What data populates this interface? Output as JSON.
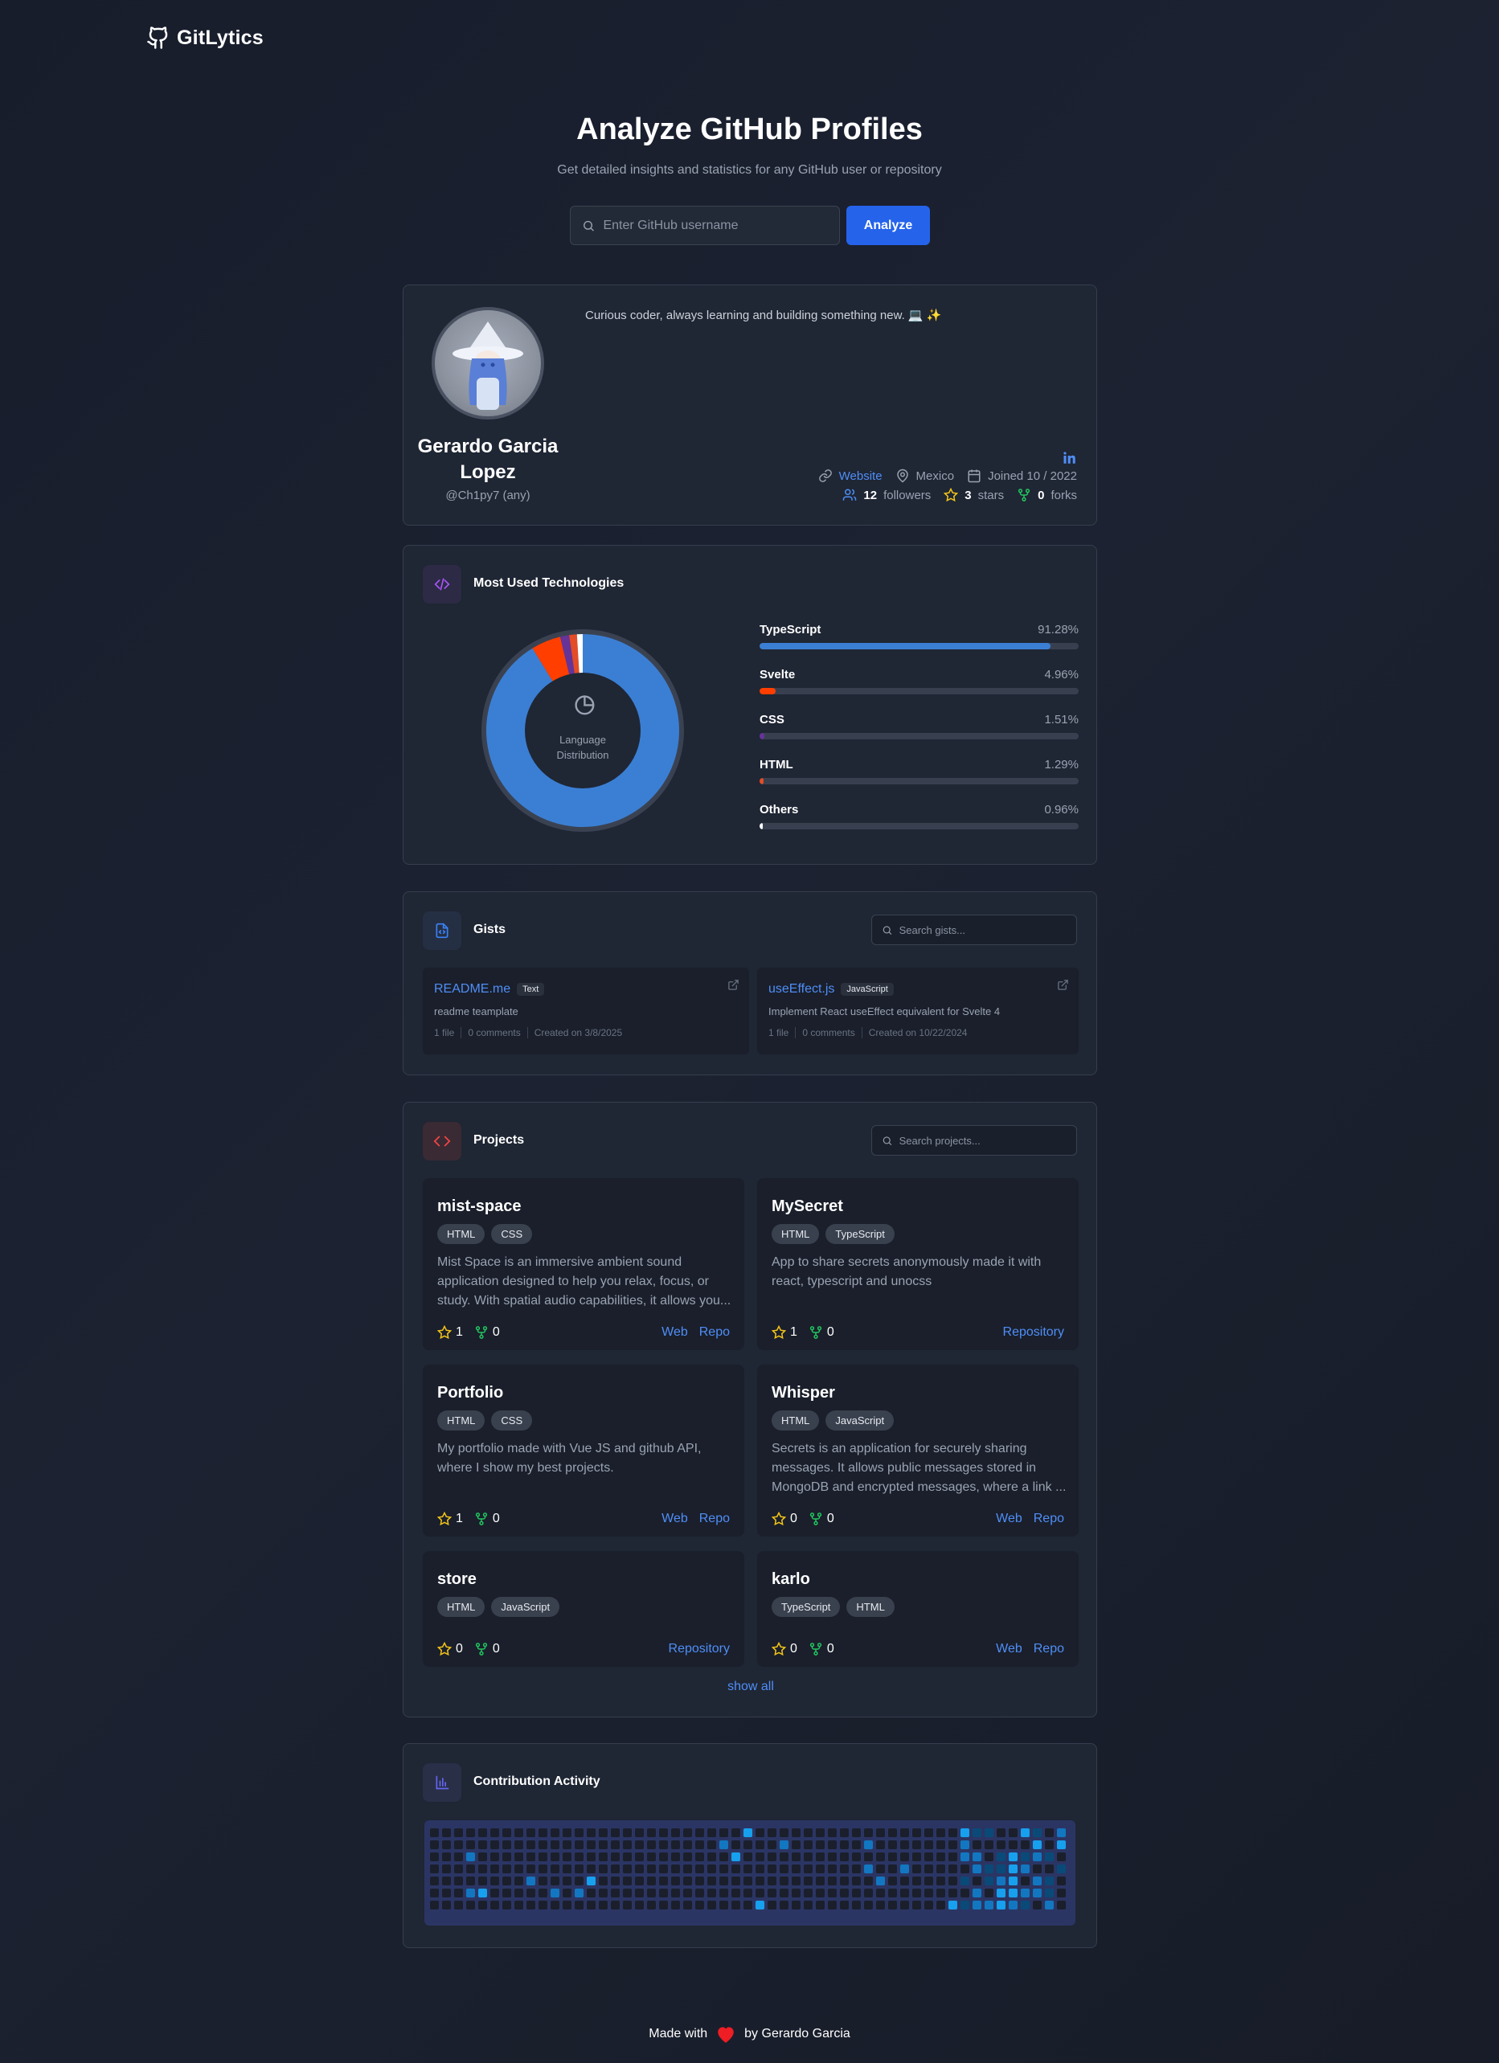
{
  "brand": {
    "name": "GitLytics"
  },
  "hero": {
    "title": "Analyze GitHub Profiles",
    "subtitle": "Get detailed insights and statistics for any GitHub user or repository",
    "search_placeholder": "Enter GitHub username",
    "analyze_label": "Analyze"
  },
  "profile": {
    "bio": "Curious coder, always learning and building something new. 💻 ✨",
    "name": "Gerardo Garcia Lopez",
    "handle": "@Ch1py7 (any)",
    "website_label": "Website",
    "location": "Mexico",
    "joined": "Joined 10 / 2022",
    "followers_count": "12",
    "followers_label": "followers",
    "stars_count": "3",
    "stars_label": "stars",
    "forks_count": "0",
    "forks_label": "forks"
  },
  "technologies": {
    "title": "Most Used Technologies",
    "chart_center_label": "Language Distribution",
    "languages": [
      {
        "name": "TypeScript",
        "pct": "91.28%",
        "value": 91.28,
        "color": "#3b7fd4"
      },
      {
        "name": "Svelte",
        "pct": "4.96%",
        "value": 4.96,
        "color": "#ff3e00"
      },
      {
        "name": "CSS",
        "pct": "1.51%",
        "value": 1.51,
        "color": "#663399"
      },
      {
        "name": "HTML",
        "pct": "1.29%",
        "value": 1.29,
        "color": "#e34c26"
      },
      {
        "name": "Others",
        "pct": "0.96%",
        "value": 0.96,
        "color": "#ffffff"
      }
    ]
  },
  "chart_data": {
    "type": "pie",
    "categories": [
      "TypeScript",
      "Svelte",
      "CSS",
      "HTML",
      "Others"
    ],
    "values": [
      91.28,
      4.96,
      1.51,
      1.29,
      0.96
    ],
    "title": "Most Used Technologies"
  },
  "gists": {
    "title": "Gists",
    "search_placeholder": "Search gists...",
    "items": [
      {
        "name": "README.me",
        "badge": "Text",
        "desc": "readme teamplate",
        "files": "1 file",
        "comments": "0 comments",
        "created": "Created on 3/8/2025"
      },
      {
        "name": "useEffect.js",
        "badge": "JavaScript",
        "desc": "Implement React useEffect equivalent for Svelte 4",
        "files": "1 file",
        "comments": "0 comments",
        "created": "Created on 10/22/2024"
      }
    ]
  },
  "projects": {
    "title": "Projects",
    "search_placeholder": "Search projects...",
    "show_all": "show all",
    "items": [
      {
        "name": "mist-space",
        "tags": [
          "HTML",
          "CSS"
        ],
        "desc": "Mist Space is an immersive ambient sound application designed to help you relax, focus, or study. With spatial audio capabilities, it allows you...",
        "stars": "1",
        "forks": "0",
        "links": [
          "Web",
          "Repo"
        ]
      },
      {
        "name": "MySecret",
        "tags": [
          "HTML",
          "TypeScript"
        ],
        "desc": "App to share secrets anonymously made it with react, typescript and unocss",
        "stars": "1",
        "forks": "0",
        "links": [
          "Repository"
        ]
      },
      {
        "name": "Portfolio",
        "tags": [
          "HTML",
          "CSS"
        ],
        "desc": "My portfolio made with Vue JS and github API, where I show my best projects.",
        "stars": "1",
        "forks": "0",
        "links": [
          "Web",
          "Repo"
        ]
      },
      {
        "name": "Whisper",
        "tags": [
          "HTML",
          "JavaScript"
        ],
        "desc": "Secrets is an application for securely sharing messages. It allows public messages stored in MongoDB and encrypted messages, where a link ...",
        "stars": "0",
        "forks": "0",
        "links": [
          "Web",
          "Repo"
        ]
      },
      {
        "name": "store",
        "tags": [
          "HTML",
          "JavaScript"
        ],
        "desc": "",
        "stars": "0",
        "forks": "0",
        "links": [
          "Repository"
        ]
      },
      {
        "name": "karlo",
        "tags": [
          "TypeScript",
          "HTML"
        ],
        "desc": "",
        "stars": "0",
        "forks": "0",
        "links": [
          "Web",
          "Repo"
        ]
      }
    ]
  },
  "contributions": {
    "title": "Contribution Activity",
    "colors": [
      "#1a1f2b",
      "#0a4a78",
      "#1277c0",
      "#17a0ee"
    ]
  },
  "footer": {
    "prefix": "Made with",
    "suffix": "by Gerardo Garcia"
  }
}
